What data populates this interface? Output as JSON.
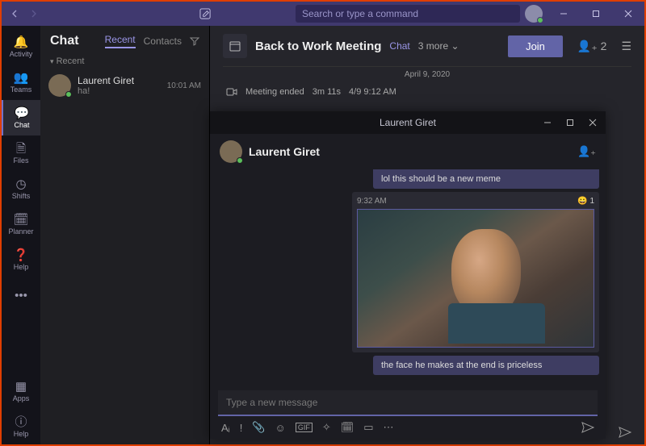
{
  "search": {
    "placeholder": "Search or type a command"
  },
  "rail": {
    "items": [
      {
        "icon": "bell-icon",
        "label": "Activity"
      },
      {
        "icon": "chat-icon",
        "label": "Chat",
        "active": true
      },
      {
        "icon": "teams-icon",
        "label": "Teams"
      },
      {
        "icon": "files-icon",
        "label": "Files"
      },
      {
        "icon": "shifts-icon",
        "label": "Shifts"
      },
      {
        "icon": "planner-icon",
        "label": "Planner"
      },
      {
        "icon": "help-icon",
        "label": "Help"
      }
    ],
    "more": "•••",
    "bottom": [
      {
        "icon": "apps-icon",
        "label": "Apps"
      },
      {
        "icon": "help-icon",
        "label": "Help"
      }
    ]
  },
  "panel": {
    "title": "Chat",
    "tabs": {
      "recent": "Recent",
      "contacts": "Contacts"
    },
    "section": "Recent",
    "chat": {
      "name": "Laurent Giret",
      "preview": "ha!",
      "time": "10:01 AM"
    }
  },
  "meeting": {
    "title": "Back to Work Meeting",
    "tab": "Chat",
    "more": "3 more",
    "join": "Join",
    "participants": "2",
    "date": "April 9, 2020",
    "system": {
      "text": "Meeting ended",
      "duration": "3m 11s",
      "at": "4/9 9:12 AM"
    }
  },
  "popup": {
    "title": "Laurent Giret",
    "name": "Laurent Giret",
    "bubble_top": "lol this should be a new meme",
    "msg": {
      "time": "9:32 AM",
      "reaction_count": "1"
    },
    "bubble_bottom": "the face he makes at the end is priceless",
    "input_placeholder": "Type a new message"
  },
  "colors": {
    "accent": "#6264a7"
  }
}
